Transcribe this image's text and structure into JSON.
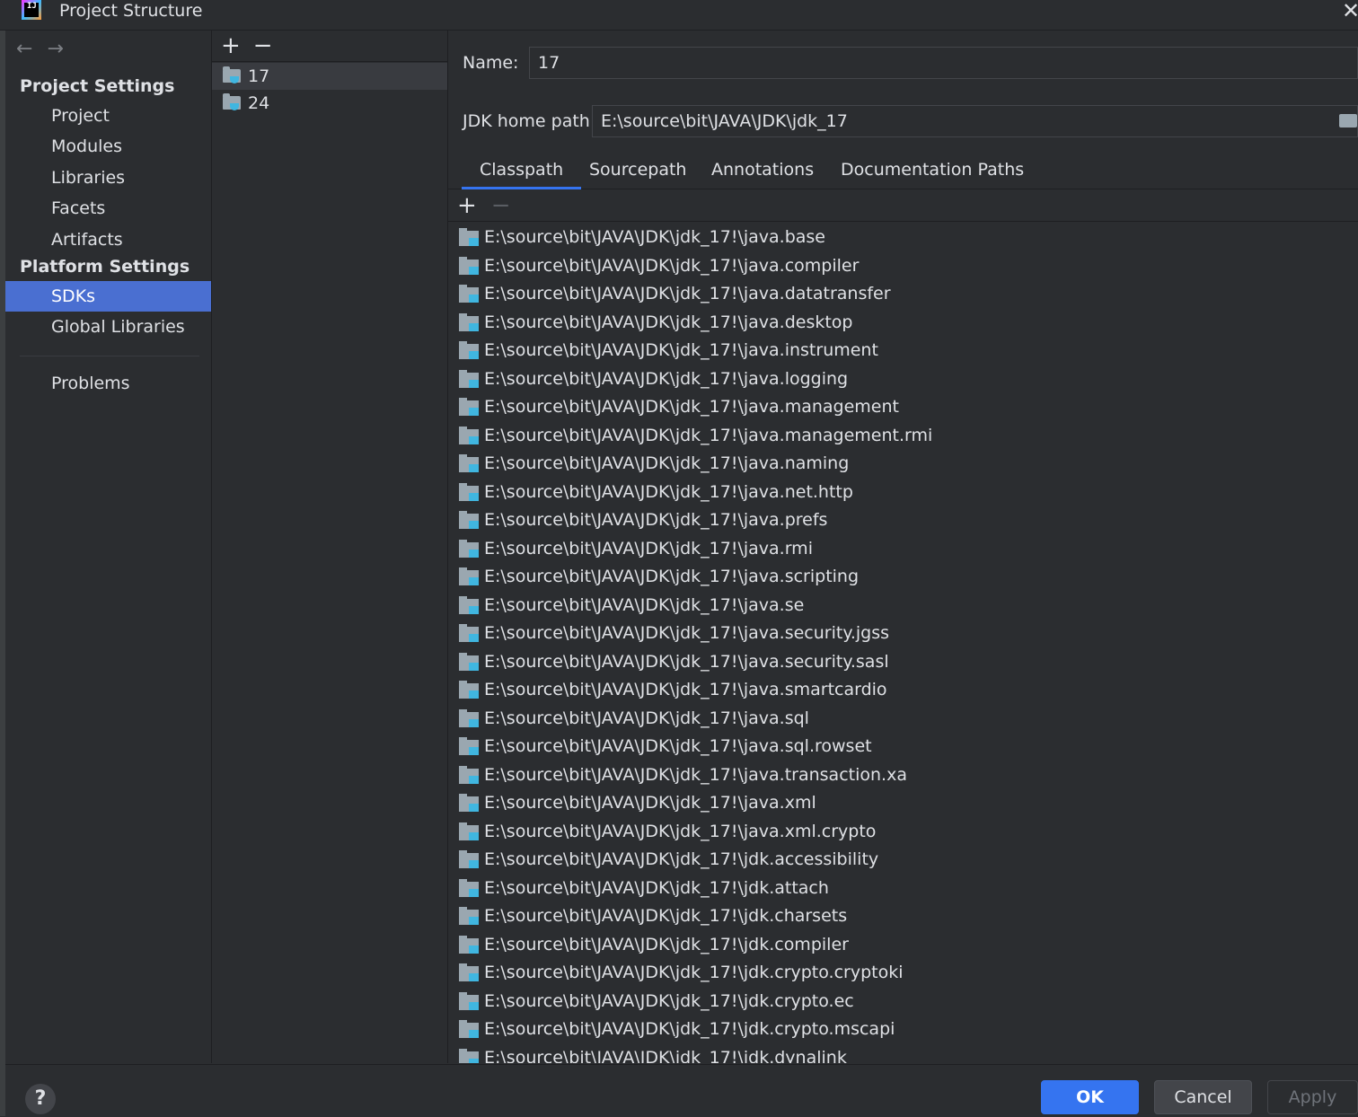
{
  "window": {
    "title": "Project Structure",
    "logo_text": "IJ"
  },
  "nav": {
    "back": "←",
    "forward": "→"
  },
  "sidebar": {
    "project_settings_header": "Project Settings",
    "project_items": [
      "Project",
      "Modules",
      "Libraries",
      "Facets",
      "Artifacts"
    ],
    "platform_settings_header": "Platform Settings",
    "platform_items": [
      "SDKs",
      "Global Libraries"
    ],
    "selected": "SDKs",
    "other_items": [
      "Problems"
    ]
  },
  "sdk_list": {
    "add": "+",
    "remove": "−",
    "items": [
      "17",
      "24"
    ],
    "selected": "17"
  },
  "detail": {
    "name_label": "Name:",
    "name_value": "17",
    "jdk_home_label": "JDK home path:",
    "jdk_home_value": "E:\\source\\bit\\JAVA\\JDK\\jdk_17",
    "tabs": [
      "Classpath",
      "Sourcepath",
      "Annotations",
      "Documentation Paths"
    ],
    "active_tab": "Classpath",
    "path_add": "+",
    "path_remove": "−",
    "classpath": [
      "E:\\source\\bit\\JAVA\\JDK\\jdk_17!\\java.base",
      "E:\\source\\bit\\JAVA\\JDK\\jdk_17!\\java.compiler",
      "E:\\source\\bit\\JAVA\\JDK\\jdk_17!\\java.datatransfer",
      "E:\\source\\bit\\JAVA\\JDK\\jdk_17!\\java.desktop",
      "E:\\source\\bit\\JAVA\\JDK\\jdk_17!\\java.instrument",
      "E:\\source\\bit\\JAVA\\JDK\\jdk_17!\\java.logging",
      "E:\\source\\bit\\JAVA\\JDK\\jdk_17!\\java.management",
      "E:\\source\\bit\\JAVA\\JDK\\jdk_17!\\java.management.rmi",
      "E:\\source\\bit\\JAVA\\JDK\\jdk_17!\\java.naming",
      "E:\\source\\bit\\JAVA\\JDK\\jdk_17!\\java.net.http",
      "E:\\source\\bit\\JAVA\\JDK\\jdk_17!\\java.prefs",
      "E:\\source\\bit\\JAVA\\JDK\\jdk_17!\\java.rmi",
      "E:\\source\\bit\\JAVA\\JDK\\jdk_17!\\java.scripting",
      "E:\\source\\bit\\JAVA\\JDK\\jdk_17!\\java.se",
      "E:\\source\\bit\\JAVA\\JDK\\jdk_17!\\java.security.jgss",
      "E:\\source\\bit\\JAVA\\JDK\\jdk_17!\\java.security.sasl",
      "E:\\source\\bit\\JAVA\\JDK\\jdk_17!\\java.smartcardio",
      "E:\\source\\bit\\JAVA\\JDK\\jdk_17!\\java.sql",
      "E:\\source\\bit\\JAVA\\JDK\\jdk_17!\\java.sql.rowset",
      "E:\\source\\bit\\JAVA\\JDK\\jdk_17!\\java.transaction.xa",
      "E:\\source\\bit\\JAVA\\JDK\\jdk_17!\\java.xml",
      "E:\\source\\bit\\JAVA\\JDK\\jdk_17!\\java.xml.crypto",
      "E:\\source\\bit\\JAVA\\JDK\\jdk_17!\\jdk.accessibility",
      "E:\\source\\bit\\JAVA\\JDK\\jdk_17!\\jdk.attach",
      "E:\\source\\bit\\JAVA\\JDK\\jdk_17!\\jdk.charsets",
      "E:\\source\\bit\\JAVA\\JDK\\jdk_17!\\jdk.compiler",
      "E:\\source\\bit\\JAVA\\JDK\\jdk_17!\\jdk.crypto.cryptoki",
      "E:\\source\\bit\\JAVA\\JDK\\jdk_17!\\jdk.crypto.ec",
      "E:\\source\\bit\\JAVA\\JDK\\jdk_17!\\jdk.crypto.mscapi",
      "E:\\source\\bit\\JAVA\\JDK\\jdk_17!\\jdk.dynalink"
    ]
  },
  "footer": {
    "help": "?",
    "ok": "OK",
    "cancel": "Cancel",
    "apply": "Apply"
  },
  "icons": {
    "sdk_item": "jdk-folder-icon",
    "classpath_item": "module-folder-icon",
    "browse": "folder-browse-icon",
    "close": "close-icon"
  },
  "colors": {
    "accent": "#3574f0",
    "selection": "#4a6fd1",
    "background": "#2b2d30"
  }
}
